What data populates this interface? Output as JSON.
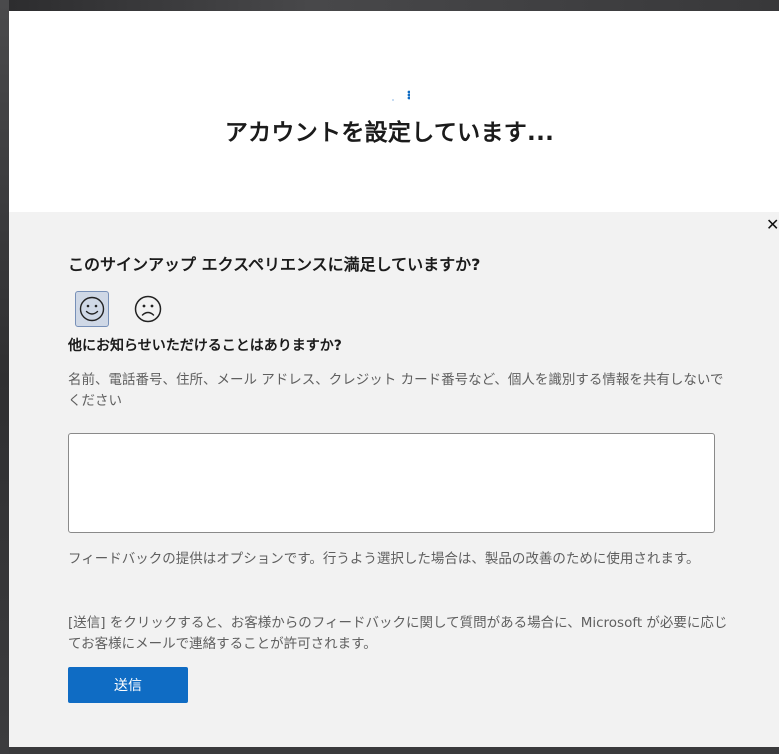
{
  "setup": {
    "title": "アカウントを設定しています..."
  },
  "feedback": {
    "question": "このサインアップ エクスペリエンスに満足していますか?",
    "happy_icon": "smiley-face-icon",
    "sad_icon": "frowning-face-icon",
    "selected": "happy",
    "comment_question": "他にお知らせいただけることはありますか?",
    "comment_hint": "名前、電話番号、住所、メール アドレス、クレジット カード番号など、個人を識別する情報を共有しないでください",
    "comment_value": "",
    "optional_note": "フィードバックの提供はオプションです。行うよう選択した場合は、製品の改善のために使用されます。",
    "consent_note": "[送信] をクリックすると、お客様からのフィードバックに関して質問がある場合に、Microsoft が必要に応じてお客様にメールで連絡することが許可されます。",
    "submit_label": "送信",
    "close_icon": "close-icon"
  },
  "colors": {
    "accent": "#0f6cc4",
    "panel_bg": "#f2f2f2",
    "selected_face_bg": "#cfd8e6"
  }
}
